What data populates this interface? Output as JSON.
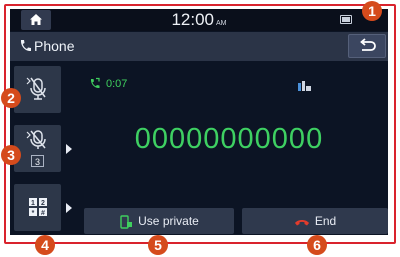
{
  "status_bar": {
    "time": "12:00",
    "ampm": "AM",
    "home_icon": "home-icon",
    "battery_icon": "battery-icon"
  },
  "header": {
    "title": "Phone",
    "phone_icon": "phone-handset-icon",
    "back_icon": "back-arrow-icon"
  },
  "side_buttons": {
    "privacy_mode_icon": "mic-mute-icon",
    "mute_icon": "mic-mute-icon",
    "mute_badge": "3",
    "keypad_icon": "keypad-icon"
  },
  "call": {
    "timer": "0:07",
    "number": "00000000000"
  },
  "bottom_buttons": {
    "use_private": "Use private",
    "end": "End"
  },
  "callouts": [
    "1",
    "2",
    "3",
    "4",
    "5",
    "6"
  ],
  "colors": {
    "accent_green": "#3ed062",
    "callout_orange": "#d54b1c",
    "frame_red": "#d9232d",
    "end_red": "#e23b2c"
  }
}
